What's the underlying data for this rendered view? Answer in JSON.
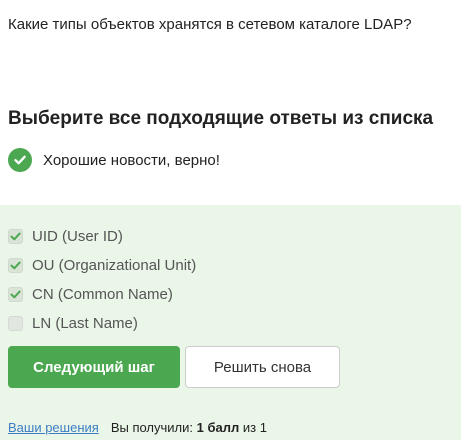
{
  "question": {
    "text": "Какие типы объектов хранятся в сетевом каталоге LDAP?"
  },
  "instruction": {
    "text": "Выберите все подходящие ответы из списка"
  },
  "feedback": {
    "icon": "check-circle-icon",
    "text": "Хорошие новости, верно!",
    "color": "#4ca850"
  },
  "options": [
    {
      "label": "UID (User ID)",
      "checked": true
    },
    {
      "label": "OU (Organizational Unit)",
      "checked": true
    },
    {
      "label": "CN (Common Name)",
      "checked": true
    },
    {
      "label": "LN (Last Name)",
      "checked": false
    }
  ],
  "buttons": {
    "next_label": "Следующий шаг",
    "retry_label": "Решить снова"
  },
  "footer": {
    "solutions_link": "Ваши решения",
    "received_prefix": "Вы получили:",
    "score": "1 балл",
    "score_of": "из 1"
  },
  "colors": {
    "accent": "#4ca850",
    "panel_background": "#eaf6e8",
    "link": "#3c7dc4"
  }
}
